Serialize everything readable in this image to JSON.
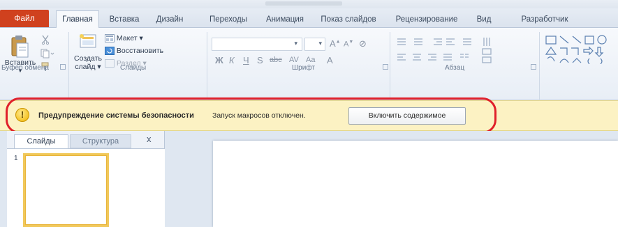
{
  "tabs": {
    "file": "Файл",
    "home": "Главная",
    "insert": "Вставка",
    "design": "Дизайн",
    "transitions": "Переходы",
    "animations": "Анимация",
    "slideshow": "Показ слайдов",
    "review": "Рецензирование",
    "view": "Вид",
    "developer": "Разработчик"
  },
  "ribbon": {
    "clipboard": {
      "paste": "Вставить",
      "group": "Буфер обмена"
    },
    "slides": {
      "new_slide_1": "Создать",
      "new_slide_2": "слайд",
      "layout": "Макет",
      "reset": "Восстановить",
      "section": "Раздел",
      "group": "Слайды"
    },
    "font": {
      "group": "Шрифт"
    },
    "paragraph": {
      "group": "Абзац"
    }
  },
  "message_bar": {
    "title": "Предупреждение системы безопасности",
    "text": "Запуск макросов отключен.",
    "button": "Включить содержимое",
    "icon_glyph": "!"
  },
  "left_pane": {
    "tab_slides": "Слайды",
    "tab_outline": "Структура",
    "close": "x",
    "slide_number": "1"
  },
  "colors": {
    "file_tab": "#d0411e",
    "message_bar": "#fcf2c3",
    "highlight": "#e0202a",
    "thumbnail_border": "#f1c85a"
  }
}
